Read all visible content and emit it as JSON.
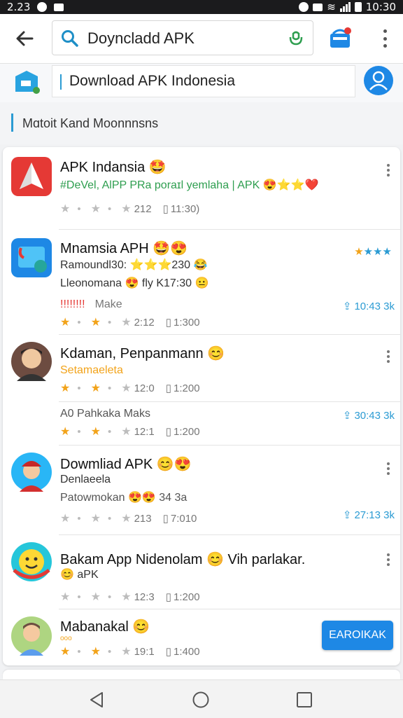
{
  "status_bar": {
    "time": "2.23",
    "clock": "10:30"
  },
  "search": {
    "query": "Doyncladd APK"
  },
  "source": {
    "field_text": "Download APK Indonesia"
  },
  "section": {
    "title": "Mɑtoit Kand Moonnnsns"
  },
  "apps": [
    {
      "title": "APK Indansia 🤩",
      "subtitle": "#DeVel, AlPP PRa poraɪl yemlaha | APK 😍⭐⭐❤️",
      "rating_count": "212",
      "size": "11:30)",
      "more": true
    },
    {
      "title": "Mnamsia APH 🤩😍",
      "subtitle": "Ramoundl30: ⭐⭐⭐230 😂",
      "subtitle2": "Lleonomana 😍 fly    K17:30 😐",
      "extra_line": "Make",
      "downloads": "10:43 3k",
      "rating_count": "2:12",
      "size": "1:300",
      "side_stars": true
    },
    {
      "title": "Kdaman, Penpanmann 😊",
      "subtitle": "Setamaeleta",
      "rating_count": "12:0",
      "size": "1:200",
      "more": true
    },
    {
      "title": "",
      "subtitle": "A0 Pahkaka Maks",
      "rating_count": "12:1",
      "size": "1:200",
      "downloads": "30:43 3k"
    },
    {
      "title": "Dowmliad APK 😊😍",
      "subtitle": "Denlaeela",
      "subtitle2": "Patowmokan 😍😍    34 3a",
      "rating_count": "213",
      "size": "7:010",
      "downloads": "27:13 3k",
      "more": true
    },
    {
      "title": "Bakam App Nidenolam 😊 Vih parlakar.",
      "subtitle": "😊 aPK",
      "rating_count": "12:3",
      "size": "1:200",
      "more": true
    },
    {
      "title": "Mabanakal 😊",
      "subtitle": "ooo",
      "rating_count": "19:1",
      "size": "1:400",
      "button": "EAROIKAK"
    }
  ],
  "colors": {
    "accent": "#1e88e5",
    "star": "#f2a31a",
    "link": "#2b9bd3"
  }
}
